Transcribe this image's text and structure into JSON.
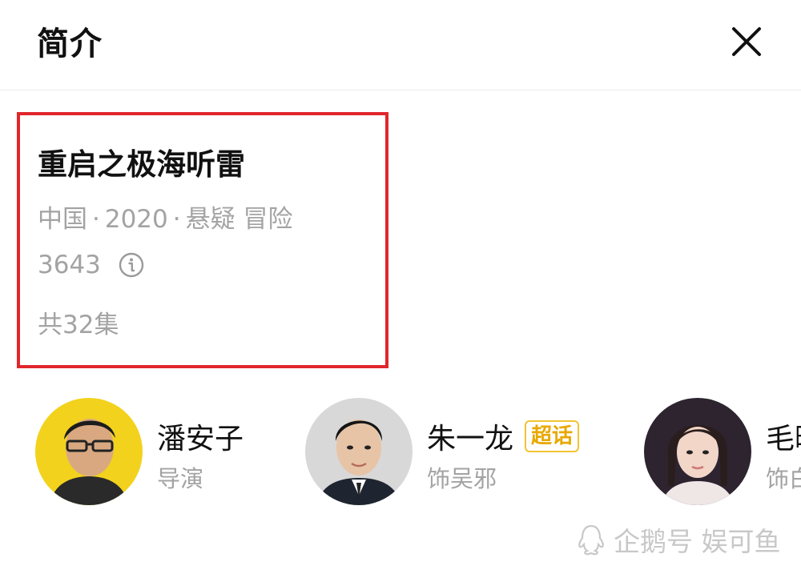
{
  "header": {
    "title": "简介"
  },
  "show": {
    "title": "重启之极海听雷",
    "country": "中国",
    "year": "2020",
    "genres": "悬疑 冒险",
    "rating_count": "3643",
    "episodes": "共32集"
  },
  "cast": [
    {
      "name": "潘安子",
      "role": "导演",
      "badge": ""
    },
    {
      "name": "朱一龙",
      "role": "饰吴邪",
      "badge": "超话"
    },
    {
      "name": "毛晓彤",
      "role": "饰白昊天",
      "badge": ""
    }
  ],
  "watermark": {
    "text": "企鹅号 娱可鱼"
  },
  "icons": {
    "close": "close-icon",
    "info": "info-icon",
    "watermark": "qq-penguin-icon"
  },
  "colors": {
    "highlight_border": "#e0262d",
    "badge": "#e8a800",
    "secondary_text": "#a3a3a3"
  }
}
